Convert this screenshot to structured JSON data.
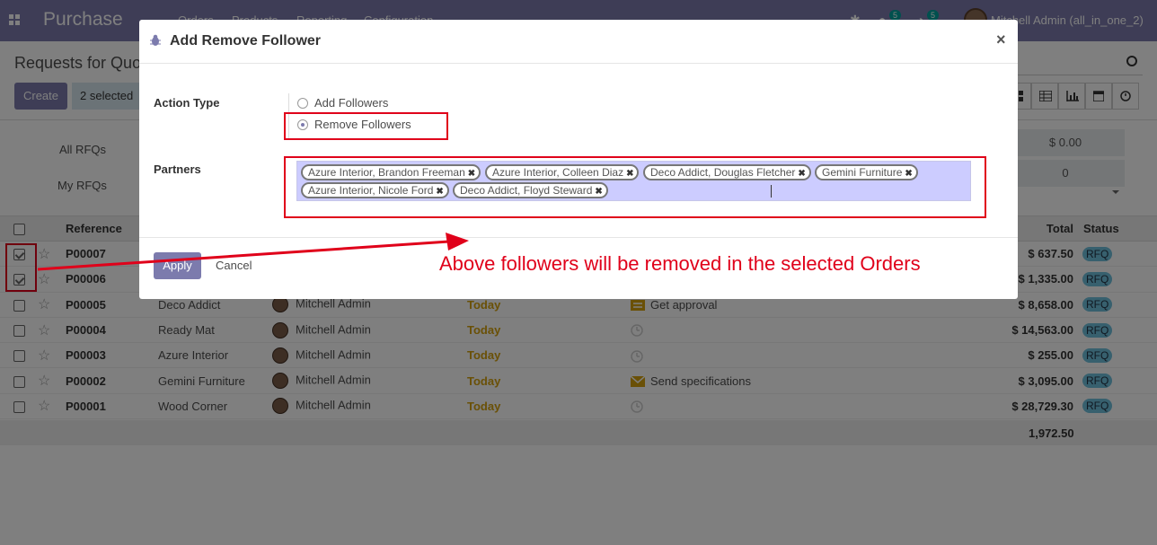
{
  "nav": {
    "app_name": "Purchase",
    "menus": [
      "Orders",
      "Products",
      "Reporting",
      "Configuration"
    ],
    "chat_badge": "5",
    "activity_badge": "5",
    "user": "Mitchell Admin (all_in_one_2)"
  },
  "control_panel": {
    "breadcrumb": "Requests for Quotation",
    "create_label": "Create",
    "selected_label": "2 selected"
  },
  "dashboard": {
    "all_rfqs": "All RFQs",
    "my_rfqs": "My RFQs",
    "amount_value": "$ 0.00",
    "count_value": "0"
  },
  "list": {
    "headers": {
      "reference": "Reference",
      "total": "Total",
      "status": "Status"
    },
    "rows": [
      {
        "ref": "P00007",
        "vendor": "",
        "buyer": "",
        "date": "",
        "activity": "",
        "total": "$ 637.50",
        "status": "RFQ",
        "checked": true
      },
      {
        "ref": "P00006",
        "vendor": "",
        "buyer": "",
        "date": "",
        "activity": "",
        "total": "$ 1,335.00",
        "status": "RFQ",
        "checked": true
      },
      {
        "ref": "P00005",
        "vendor": "Deco Addict",
        "buyer": "Mitchell Admin",
        "date": "Today",
        "activity": "Get approval",
        "total": "$ 8,658.00",
        "status": "RFQ",
        "checked": false
      },
      {
        "ref": "P00004",
        "vendor": "Ready Mat",
        "buyer": "Mitchell Admin",
        "date": "Today",
        "activity": "",
        "total": "$ 14,563.00",
        "status": "RFQ",
        "checked": false
      },
      {
        "ref": "P00003",
        "vendor": "Azure Interior",
        "buyer": "Mitchell Admin",
        "date": "Today",
        "activity": "",
        "total": "$ 255.00",
        "status": "RFQ",
        "checked": false
      },
      {
        "ref": "P00002",
        "vendor": "Gemini Furniture",
        "buyer": "Mitchell Admin",
        "date": "Today",
        "activity": "Send specifications",
        "total": "$ 3,095.00",
        "status": "RFQ",
        "checked": false
      },
      {
        "ref": "P00001",
        "vendor": "Wood Corner",
        "buyer": "Mitchell Admin",
        "date": "Today",
        "activity": "",
        "total": "$ 28,729.30",
        "status": "RFQ",
        "checked": false
      }
    ],
    "footer_total": "1,972.50"
  },
  "modal": {
    "title": "Add Remove Follower",
    "action_type_label": "Action Type",
    "option_add": "Add Followers",
    "option_remove": "Remove Followers",
    "partners_label": "Partners",
    "partners": [
      "Azure Interior, Brandon Freeman",
      "Azure Interior, Colleen Diaz",
      "Deco Addict, Douglas Fletcher",
      "Gemini Furniture",
      "Azure Interior, Nicole Ford",
      "Deco Addict, Floyd Steward"
    ],
    "apply_label": "Apply",
    "cancel_label": "Cancel"
  },
  "annotation": "Above followers will be removed in the selected Orders",
  "colors": {
    "brand": "#7c7bad",
    "annotation": "#e0001a",
    "status": "#6fc0dc",
    "today": "#d4a10d"
  }
}
